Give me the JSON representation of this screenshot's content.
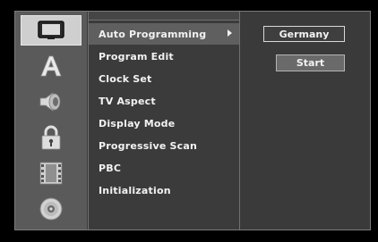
{
  "menu": {
    "items": [
      {
        "label": "Auto Programming",
        "selected": true
      },
      {
        "label": "Program Edit",
        "selected": false
      },
      {
        "label": "Clock Set",
        "selected": false
      },
      {
        "label": "TV Aspect",
        "selected": false
      },
      {
        "label": "Display Mode",
        "selected": false
      },
      {
        "label": "Progressive Scan",
        "selected": false
      },
      {
        "label": "PBC",
        "selected": false
      },
      {
        "label": "Initialization",
        "selected": false
      }
    ]
  },
  "categories": [
    {
      "icon": "tv-icon",
      "selected": true
    },
    {
      "icon": "language-a-icon",
      "selected": false
    },
    {
      "icon": "speaker-icon",
      "selected": false
    },
    {
      "icon": "lock-icon",
      "selected": false
    },
    {
      "icon": "film-icon",
      "selected": false
    },
    {
      "icon": "disc-icon",
      "selected": false
    }
  ],
  "options": {
    "country_value": "Germany",
    "start_button_label": "Start"
  },
  "colors": {
    "background": "#000000",
    "panel": "#3a3a3a",
    "icon_column": "#5a5a5a",
    "selected_row": "#5f5f5f",
    "selected_icon": "#cfcfcf",
    "text": "#f2f2f2"
  }
}
